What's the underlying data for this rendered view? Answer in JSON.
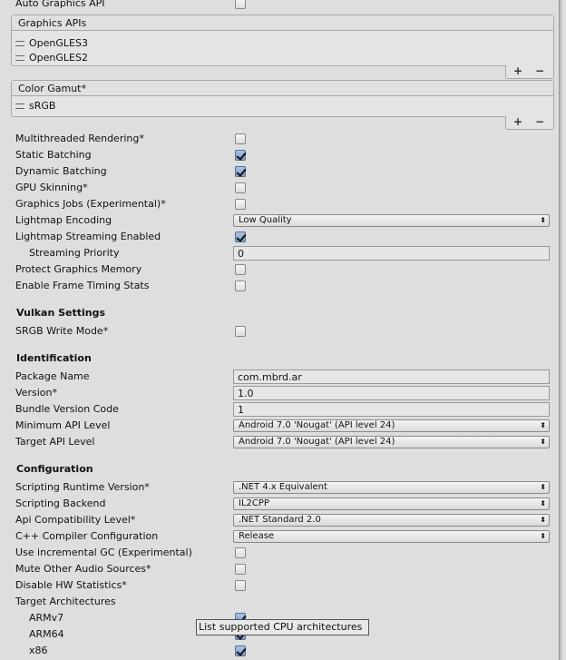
{
  "auto_graphics_api": {
    "label": "Auto Graphics API",
    "checked": false
  },
  "graphics_apis": {
    "title": "Graphics APIs",
    "items": [
      "OpenGLES3",
      "OpenGLES2"
    ],
    "add": "+",
    "remove": "−"
  },
  "color_gamut": {
    "title": "Color Gamut*",
    "items": [
      "sRGB"
    ],
    "add": "+",
    "remove": "−"
  },
  "rendering": [
    {
      "label": "Multithreaded Rendering*",
      "checked": false
    },
    {
      "label": "Static Batching",
      "checked": true
    },
    {
      "label": "Dynamic Batching",
      "checked": true
    },
    {
      "label": "GPU Skinning*",
      "checked": false
    },
    {
      "label": "Graphics Jobs (Experimental)*",
      "checked": false
    },
    {
      "label": "Lightmap Encoding",
      "value": "Low Quality"
    },
    {
      "label": "Lightmap Streaming Enabled",
      "checked": true
    },
    {
      "label": "Streaming Priority",
      "value": "0"
    },
    {
      "label": "Protect Graphics Memory",
      "checked": false
    },
    {
      "label": "Enable Frame Timing Stats",
      "checked": false
    }
  ],
  "vulkan": {
    "title": "Vulkan Settings",
    "srgb_write": {
      "label": "SRGB Write Mode*",
      "checked": false
    }
  },
  "identification": {
    "title": "Identification",
    "rows": [
      {
        "label": "Package Name",
        "value": "com.mbrd.ar"
      },
      {
        "label": "Version*",
        "value": "1.0"
      },
      {
        "label": "Bundle Version Code",
        "value": "1"
      },
      {
        "label": "Minimum API Level",
        "value": "Android 7.0 'Nougat' (API level 24)"
      },
      {
        "label": "Target API Level",
        "value": "Android 7.0 'Nougat' (API level 24)"
      }
    ]
  },
  "configuration": {
    "title": "Configuration",
    "rows": [
      {
        "label": "Scripting Runtime Version*",
        "value": ".NET 4.x Equivalent"
      },
      {
        "label": "Scripting Backend",
        "value": "IL2CPP"
      },
      {
        "label": "Api Compatibility Level*",
        "value": ".NET Standard 2.0"
      },
      {
        "label": "C++ Compiler Configuration",
        "value": "Release"
      },
      {
        "label": "Use incremental GC (Experimental)",
        "checked": false
      },
      {
        "label": "Mute Other Audio Sources*",
        "checked": false
      },
      {
        "label": "Disable HW Statistics*",
        "checked": false
      },
      {
        "label": "Target Architectures"
      },
      {
        "label": "ARMv7",
        "checked": true
      },
      {
        "label": "ARM64",
        "checked": true
      },
      {
        "label": "x86",
        "checked": true
      }
    ]
  },
  "tooltip": "List supported CPU architectures",
  "dropdown_arrow": "⬍"
}
